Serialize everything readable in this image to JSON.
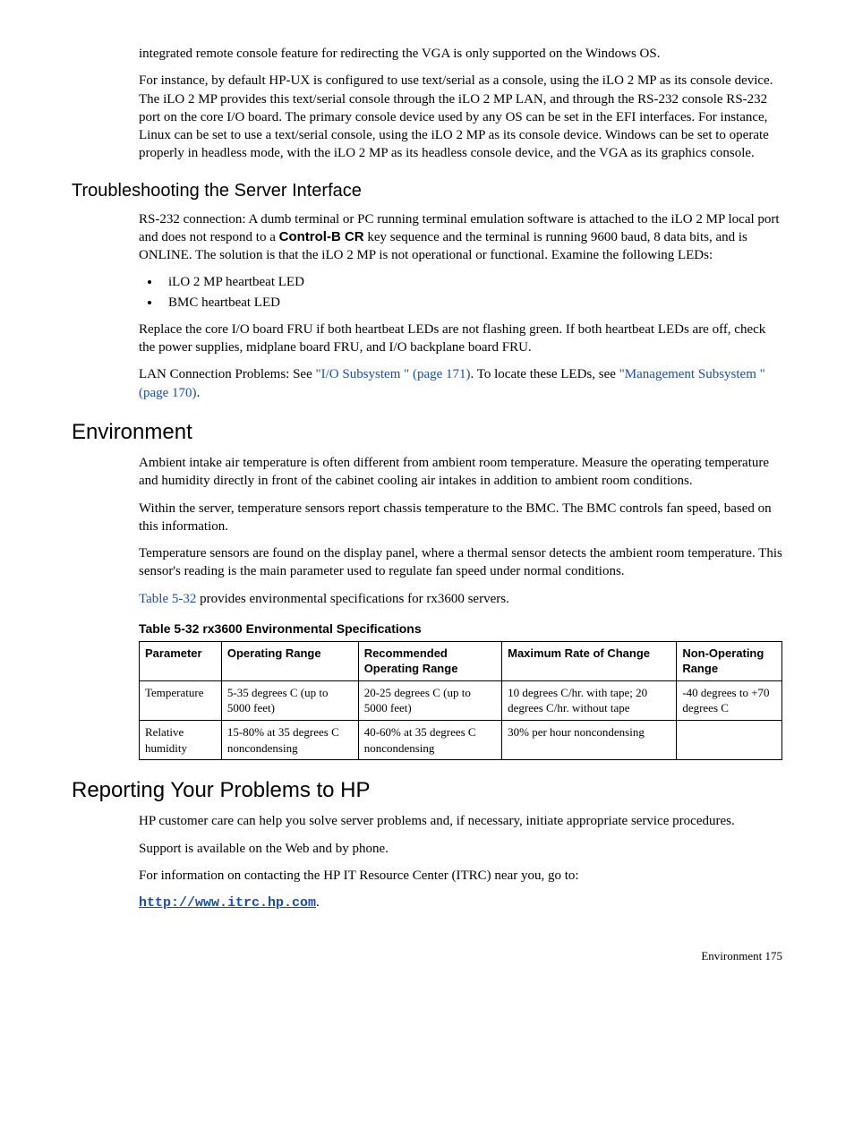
{
  "p_intro1": "integrated remote console feature for redirecting the VGA is only supported on the Windows OS.",
  "p_intro2": "For instance, by default HP-UX is configured to use text/serial as a console, using the iLO 2 MP as its console device. The iLO 2 MP provides this text/serial console through the iLO 2 MP LAN, and through the RS-232 console RS-232 port on the core I/O board. The primary console device used by any OS can be set in the EFI interfaces. For instance, Linux can be set to use a text/serial console, using the iLO 2 MP as its console device. Windows can be set to operate properly in headless mode, with the iLO 2 MP as its headless console device, and the VGA as its graphics console.",
  "h_trouble": "Troubleshooting the Server Interface",
  "p_trouble1a": "RS-232 connection: A dumb terminal or PC running terminal emulation software is attached to the iLO 2 MP local port and does not respond to a ",
  "p_trouble1_bold": "Control-B CR",
  "p_trouble1b": " key sequence and the terminal is running 9600 baud, 8 data bits, and is ONLINE. The solution is that the iLO 2 MP is not operational or functional. Examine the following LEDs:",
  "li_led1": "iLO 2 MP heartbeat LED",
  "li_led2": "BMC heartbeat LED",
  "p_trouble2": "Replace the core I/O board FRU if both heartbeat LEDs are not flashing green. If both heartbeat LEDs are off, check the power supplies, midplane board FRU, and I/O backplane board FRU.",
  "p_trouble3a": "LAN Connection Problems: See ",
  "p_trouble3_link1": "\"I/O Subsystem \" (page 171)",
  "p_trouble3b": ". To locate these LEDs, see ",
  "p_trouble3_link2": "\"Management Subsystem \" (page 170)",
  "p_trouble3c": ".",
  "h_env": "Environment",
  "p_env1": "Ambient intake air temperature is often different from ambient room temperature. Measure the operating temperature and humidity directly in front of the cabinet cooling air intakes in addition to ambient room conditions.",
  "p_env2": "Within the server, temperature sensors report chassis temperature to the BMC. The BMC controls fan speed, based on this information.",
  "p_env3": "Temperature sensors are found on the display panel, where a thermal sensor detects the ambient room temperature. This sensor's reading is the main parameter used to regulate fan speed under normal conditions.",
  "p_env4a": "",
  "p_env4_link": "Table 5-32",
  "p_env4b": " provides environmental specifications for rx3600 servers.",
  "table_caption": "Table  5-32  rx3600 Environmental Specifications",
  "th1": "Parameter",
  "th2": "Operating Range",
  "th3": "Recommended Operating Range",
  "th4": "Maximum Rate of Change",
  "th5": "Non-Operating Range",
  "r1c1": "Temperature",
  "r1c2": "5-35 degrees C (up to 5000 feet)",
  "r1c3": "20-25 degrees C (up to 5000 feet)",
  "r1c4": "10 degrees C/hr. with tape; 20 degrees C/hr. without tape",
  "r1c5": "-40 degrees to +70 degrees C",
  "r2c1": "Relative humidity",
  "r2c2": "15-80% at 35 degrees C noncondensing",
  "r2c3": "40-60% at 35 degrees C noncondensing",
  "r2c4": "30% per hour noncondensing",
  "r2c5": "",
  "h_report": "Reporting Your Problems to HP",
  "p_report1": "HP customer care can help you solve server problems and, if necessary, initiate appropriate service procedures.",
  "p_report2": "Support is available on the Web and by phone.",
  "p_report3": "For information on contacting the HP IT Resource Center (ITRC) near you, go to:",
  "p_report_link": "http://www.itrc.hp.com",
  "p_report_link_after": ".",
  "footer": "Environment    175"
}
